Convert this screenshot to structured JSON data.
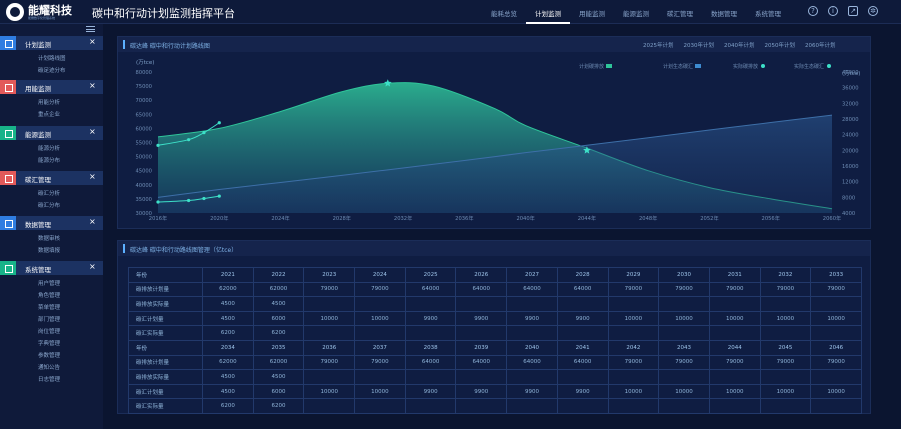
{
  "header": {
    "logo_name": "能耀科技",
    "logo_sub": "能耀数字化管理系统",
    "title": "碳中和行动计划监测指挥平台",
    "nav": [
      "能耗总览",
      "计划监测",
      "用能监测",
      "能源监测",
      "碳汇管理",
      "数据管理",
      "系统管理"
    ],
    "active_nav": "计划监测",
    "icons": [
      "help-icon",
      "info-icon",
      "fullscreen-icon",
      "settings-icon"
    ]
  },
  "sidebar": {
    "groups": [
      {
        "label": "计划监测",
        "color": "#2f7de1",
        "icon": "grid-icon",
        "items": [
          "计划路线图",
          "碳足迹分布"
        ]
      },
      {
        "label": "用能监测",
        "color": "#e25a5a",
        "icon": "share-icon",
        "items": [
          "用能分析",
          "重点企业"
        ]
      },
      {
        "label": "能源监测",
        "color": "#18b389",
        "icon": "folder-icon",
        "items": [
          "能源分析",
          "能源分布"
        ]
      },
      {
        "label": "碳汇管理",
        "color": "#e25a5a",
        "icon": "share-icon",
        "items": [
          "碳汇分析",
          "碳汇分布"
        ]
      },
      {
        "label": "数据管理",
        "color": "#2f7de1",
        "icon": "grid-icon",
        "items": [
          "数据审核",
          "数据填报"
        ]
      },
      {
        "label": "系统管理",
        "color": "#18b389",
        "icon": "folder-icon",
        "items": [
          "用户管理",
          "角色管理",
          "菜单管理",
          "部门管理",
          "岗位管理",
          "字典管理",
          "参数管理",
          "通知公告",
          "日志管理"
        ]
      }
    ]
  },
  "chart_panel": {
    "title": "碳达峰 碳中和行动计划路线图",
    "year_tabs": [
      "2025年计划",
      "2030年计划",
      "2040年计划",
      "2050年计划",
      "2060年计划"
    ]
  },
  "chart_data": {
    "type": "area",
    "title": "",
    "ylabel_left": "(万tce)",
    "ylabel_right": "(万tce)",
    "x_ticks": [
      "2016年",
      "2020年",
      "2024年",
      "2028年",
      "2032年",
      "2036年",
      "2040年",
      "2044年",
      "2048年",
      "2052年",
      "2056年",
      "2060年"
    ],
    "y_left_ticks": [
      30000,
      35000,
      40000,
      45000,
      50000,
      55000,
      60000,
      65000,
      70000,
      75000,
      80000
    ],
    "y_right_ticks": [
      4000,
      8000,
      12000,
      16000,
      20000,
      24000,
      28000,
      32000,
      36000,
      40000
    ],
    "ylim_left": [
      30000,
      80000
    ],
    "ylim_right": [
      4000,
      40000
    ],
    "xlim": [
      2016,
      2060
    ],
    "legend": [
      "计划碳排放",
      "计划生态碳汇",
      "实际碳排放",
      "实际生态碳汇"
    ],
    "legend_position": "top-right",
    "series": [
      {
        "name": "计划碳排放",
        "type": "area",
        "axis": "left",
        "color": "#2fc59a",
        "x": [
          2016,
          2020,
          2024,
          2028,
          2031,
          2034,
          2038,
          2040,
          2044,
          2048,
          2052,
          2056,
          2060
        ],
        "y": [
          57000,
          60000,
          66000,
          73000,
          76000,
          75000,
          67000,
          61000,
          53000,
          45000,
          39000,
          35000,
          31500
        ]
      },
      {
        "name": "计划生态碳汇",
        "type": "area",
        "axis": "right",
        "color": "#3d6fa8",
        "x": [
          2016,
          2020,
          2024,
          2028,
          2032,
          2036,
          2040,
          2044,
          2048,
          2052,
          2056,
          2060
        ],
        "y": [
          8000,
          10000,
          11800,
          13600,
          15500,
          17400,
          19400,
          21300,
          23200,
          25200,
          27100,
          29000
        ]
      },
      {
        "name": "实际碳排放",
        "type": "line",
        "axis": "left",
        "color": "#3de0c8",
        "x": [
          2016,
          2018,
          2019,
          2020
        ],
        "y": [
          54000,
          56000,
          58500,
          62000
        ]
      },
      {
        "name": "实际生态碳汇",
        "type": "line",
        "axis": "right",
        "color": "#3de0c8",
        "x": [
          2016,
          2018,
          2019,
          2020
        ],
        "y": [
          6800,
          7200,
          7700,
          8300
        ]
      }
    ],
    "markers": [
      {
        "series": "计划碳排放",
        "x": 2031,
        "y": 76000,
        "shape": "star"
      },
      {
        "series": "计划生态碳汇",
        "x": 2044,
        "y": 20000,
        "shape": "star"
      }
    ]
  },
  "table_panel": {
    "title": "碳达峰 碳中和行动路线图管理（亿tce）",
    "blocks": [
      {
        "year_label": "年份",
        "years": [
          "2021",
          "2022",
          "2023",
          "2024",
          "2025",
          "2026",
          "2027",
          "2028",
          "2029",
          "2030",
          "2031",
          "2032",
          "2033"
        ],
        "rows": [
          {
            "label": "碳排放计划量",
            "values": [
              "62000",
              "62000",
              "79000",
              "79000",
              "64000",
              "64000",
              "64000",
              "64000",
              "79000",
              "79000",
              "79000",
              "79000",
              "79000"
            ]
          },
          {
            "label": "碳排放实际量",
            "values": [
              "4500",
              "4500",
              "",
              "",
              "",
              "",
              "",
              "",
              "",
              "",
              "",
              "",
              ""
            ]
          },
          {
            "label": "碳汇计划量",
            "values": [
              "4500",
              "6000",
              "10000",
              "10000",
              "9900",
              "9900",
              "9900",
              "9900",
              "10000",
              "10000",
              "10000",
              "10000",
              "10000"
            ]
          },
          {
            "label": "碳汇实际量",
            "values": [
              "6200",
              "6200",
              "",
              "",
              "",
              "",
              "",
              "",
              "",
              "",
              "",
              "",
              ""
            ]
          }
        ]
      },
      {
        "year_label": "年份",
        "years": [
          "2034",
          "2035",
          "2036",
          "2037",
          "2038",
          "2039",
          "2040",
          "2041",
          "2042",
          "2043",
          "2044",
          "2045",
          "2046"
        ],
        "rows": [
          {
            "label": "碳排放计划量",
            "values": [
              "62000",
              "62000",
              "79000",
              "79000",
              "64000",
              "64000",
              "64000",
              "64000",
              "79000",
              "79000",
              "79000",
              "79000",
              "79000"
            ]
          },
          {
            "label": "碳排放实际量",
            "values": [
              "4500",
              "4500",
              "",
              "",
              "",
              "",
              "",
              "",
              "",
              "",
              "",
              "",
              ""
            ]
          },
          {
            "label": "碳汇计划量",
            "values": [
              "4500",
              "6000",
              "10000",
              "10000",
              "9900",
              "9900",
              "9900",
              "9900",
              "10000",
              "10000",
              "10000",
              "10000",
              "10000"
            ]
          },
          {
            "label": "碳汇实际量",
            "values": [
              "6200",
              "6200",
              "",
              "",
              "",
              "",
              "",
              "",
              "",
              "",
              "",
              "",
              ""
            ]
          }
        ]
      }
    ]
  }
}
